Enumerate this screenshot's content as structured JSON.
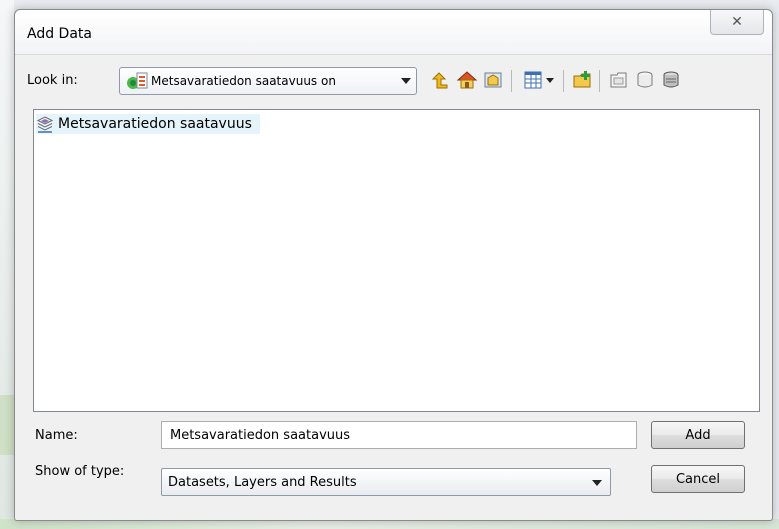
{
  "dialog": {
    "title": "Add Data",
    "close_glyph": "✕"
  },
  "look_in": {
    "label": "Look in:",
    "value": "Metsavaratiedon saatavuus on"
  },
  "toolbar": {
    "icons": [
      "up-one-level-icon",
      "home-icon",
      "connect-to-folder-icon",
      "toggle-contents-pane-icon",
      "view-menu-icon",
      "new-folder-icon",
      "new-file-geodatabase-icon",
      "new-personal-geodatabase-icon",
      "new-shapefile-icon"
    ]
  },
  "files": [
    {
      "label": "Metsavaratiedon saatavuus",
      "icon": "layer-icon",
      "selected": true
    }
  ],
  "name": {
    "label": "Name:",
    "value": "Metsavaratiedon saatavuus"
  },
  "show_of_type": {
    "label": "Show of type:",
    "value": "Datasets, Layers and Results"
  },
  "buttons": {
    "add": "Add",
    "cancel": "Cancel"
  },
  "colors": {
    "accent_selection": "#e5f3fb",
    "window_bg": "#f0f0f0"
  }
}
